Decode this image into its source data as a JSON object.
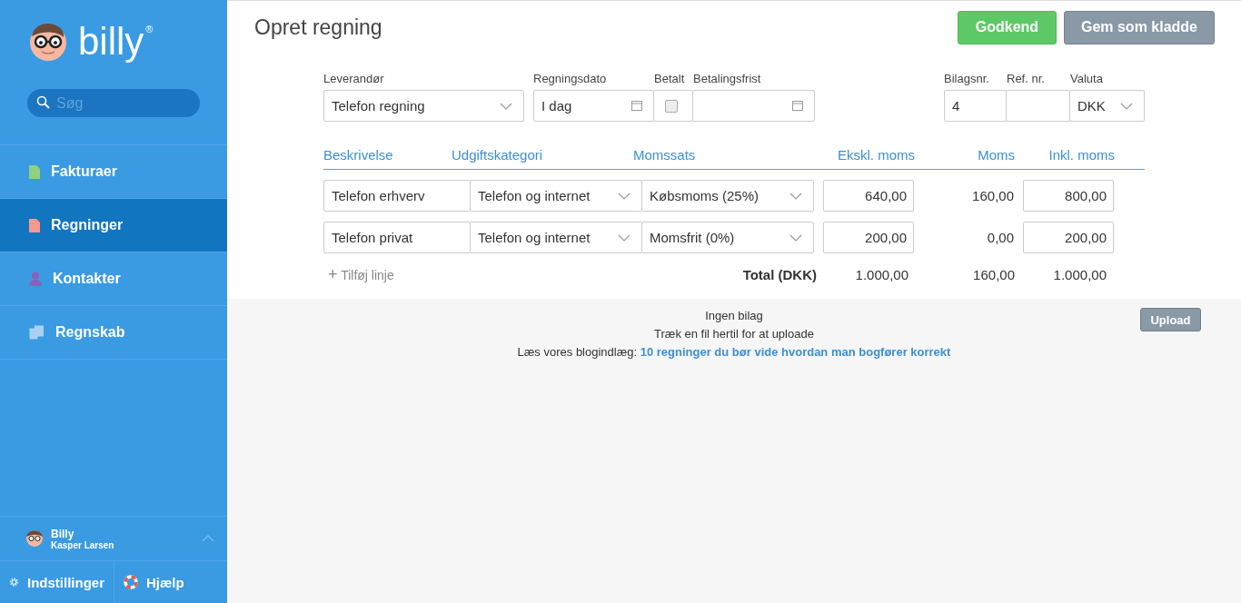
{
  "sidebar": {
    "logo": "billy",
    "logo_mark": "®",
    "search": {
      "placeholder": "Søg"
    },
    "items": [
      {
        "label": "Fakturaer",
        "selected": false,
        "kind": "doc",
        "color": "#8fd17e"
      },
      {
        "label": "Regninger",
        "selected": true,
        "kind": "doc",
        "color": "#f59a8a"
      },
      {
        "label": "Kontakter",
        "selected": false,
        "kind": "person",
        "color": "#8e5fb8"
      },
      {
        "label": "Regnskab",
        "selected": false,
        "kind": "docs",
        "color": "#a9d1f2"
      }
    ],
    "user": {
      "name": "Billy",
      "subtitle": "Kasper Larsen"
    },
    "footer": [
      {
        "label": "Indstillinger",
        "kind": "gear"
      },
      {
        "label": "Hjælp",
        "kind": "lifebuoy"
      }
    ]
  },
  "header": {
    "title": "Opret regning",
    "buttons": [
      {
        "label": "Godkend",
        "kind": "primary"
      },
      {
        "label": "Gem som kladde",
        "kind": "secondary"
      }
    ]
  },
  "form": {
    "supplier": {
      "label": "Leverandør",
      "value": "Telefon regning"
    },
    "date": {
      "label": "Regningsdato",
      "value": "I dag"
    },
    "paid": {
      "label": "Betalt",
      "checked": false
    },
    "due": {
      "label": "Betalingsfrist"
    },
    "voucher": {
      "label": "Bilagsnr.",
      "value": "4"
    },
    "ref": {
      "label": "Ref. nr."
    },
    "currency": {
      "label": "Valuta",
      "value": "DKK"
    }
  },
  "lines": {
    "columns": [
      "Beskrivelse",
      "Udgiftskategori",
      "Momssats",
      "Ekskl. moms",
      "Moms",
      "Inkl. moms"
    ],
    "rows": [
      {
        "description": "Telefon erhverv",
        "category": "Telefon og internet",
        "vat_rate": "Købsmoms (25%)",
        "excl": "640,00",
        "vat": "160,00",
        "incl": "800,00"
      },
      {
        "description": "Telefon privat",
        "category": "Telefon og internet",
        "vat_rate": "Momsfrit (0%)",
        "excl": "200,00",
        "vat": "0,00",
        "incl": "200,00"
      }
    ],
    "add_line": "Tilføj linje",
    "add_icon": "+",
    "total": {
      "label": "Total (DKK)",
      "excl": "1.000,00",
      "vat": "160,00",
      "incl": "1.000,00"
    }
  },
  "attachments": {
    "empty": "Ingen bilag",
    "hint": "Træk en fil hertil for at uploade",
    "blog_prefix": "Læs vores blogindlæg:",
    "blog_link": "10 regninger du bør vide hvordan man bogfører korrekt",
    "upload": "Upload"
  }
}
